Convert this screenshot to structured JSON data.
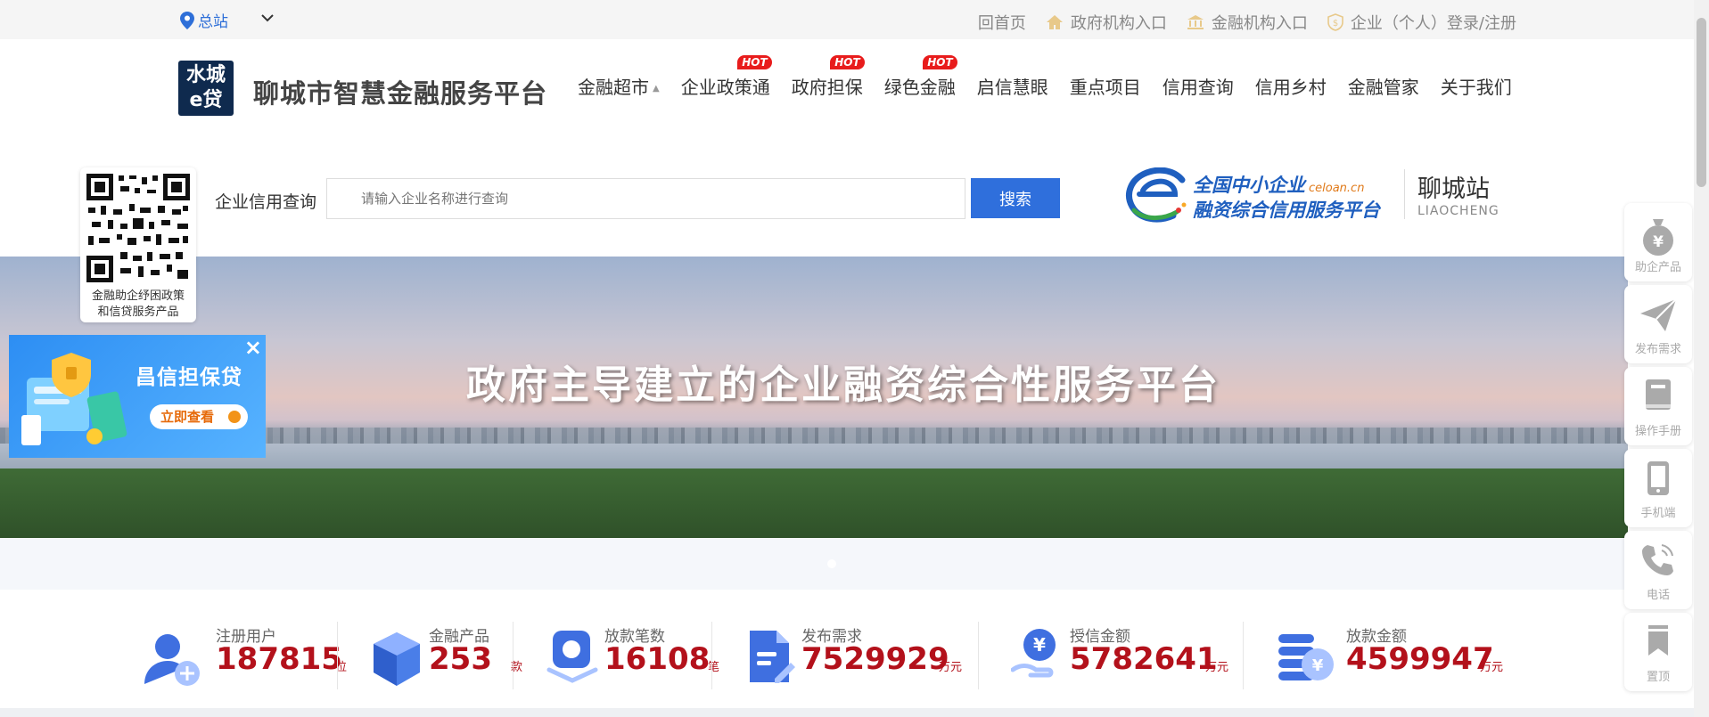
{
  "topbar": {
    "location": "总站",
    "links": [
      {
        "label": "回首页",
        "icon": "none"
      },
      {
        "label": "政府机构入口",
        "icon": "home-icon"
      },
      {
        "label": "金融机构入口",
        "icon": "bank-icon"
      },
      {
        "label": "企业（个人）登录/注册",
        "icon": "dollar-shield-icon"
      }
    ]
  },
  "header": {
    "logo_line1": "水城",
    "logo_line2": "e贷",
    "title": "聊城市智慧金融服务平台",
    "nav": [
      {
        "label": "金融超市",
        "hot": ""
      },
      {
        "label": "企业政策通",
        "hot": "HOT"
      },
      {
        "label": "政府担保",
        "hot": "HOT"
      },
      {
        "label": "绿色金融",
        "hot": "HOT"
      },
      {
        "label": "启信慧眼",
        "hot": ""
      },
      {
        "label": "重点项目",
        "hot": ""
      },
      {
        "label": "信用查询",
        "hot": ""
      },
      {
        "label": "信用乡村",
        "hot": ""
      },
      {
        "label": "金融管家",
        "hot": ""
      },
      {
        "label": "关于我们",
        "hot": ""
      }
    ]
  },
  "qr": {
    "caption_line1": "金融助企纾困政策",
    "caption_line2": "和信贷服务产品"
  },
  "search": {
    "label": "企业信用查询",
    "placeholder": "请输入企业名称进行查询",
    "button": "搜索"
  },
  "celoan": {
    "line1": "全国中小企业",
    "domain": "celoan.cn",
    "line2": "融资综合信用服务平台"
  },
  "station": {
    "cn": "聊城站",
    "en": "LIAOCHENG"
  },
  "banner": {
    "title": "政府主导建立的企业融资综合性服务平台"
  },
  "promo": {
    "title": "昌信担保贷",
    "button": "立即查看",
    "close": "×"
  },
  "stats": [
    {
      "label": "注册用户",
      "value": "187815",
      "unit": "位"
    },
    {
      "label": "金融产品",
      "value": "253",
      "unit": "款"
    },
    {
      "label": "放款笔数",
      "value": "16108",
      "unit": "笔"
    },
    {
      "label": "发布需求",
      "value": "7529929",
      "unit": "万元"
    },
    {
      "label": "授信金额",
      "value": "5782641",
      "unit": "万元"
    },
    {
      "label": "放款金额",
      "value": "4599947",
      "unit": "万元"
    }
  ],
  "float": [
    {
      "label": "助企产品",
      "icon": "money-bag-icon"
    },
    {
      "label": "发布需求",
      "icon": "paper-plane-icon"
    },
    {
      "label": "操作手册",
      "icon": "book-icon"
    },
    {
      "label": "手机端",
      "icon": "phone-icon"
    },
    {
      "label": "电话",
      "icon": "telephone-icon"
    },
    {
      "label": "置顶",
      "icon": "bookmark-icon"
    }
  ],
  "colors": {
    "brand_blue": "#2f6fdc",
    "stat_red": "#b3111b",
    "hot_red": "#e81c1c"
  }
}
